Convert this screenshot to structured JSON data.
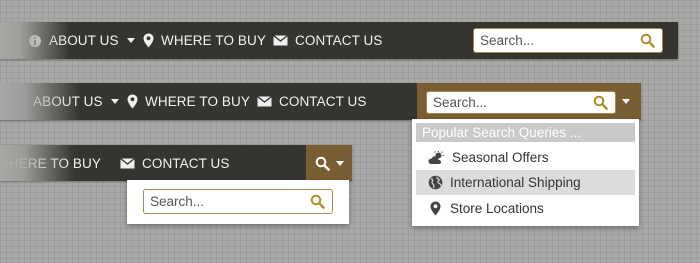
{
  "nav1": {
    "about": "ABOUT US",
    "where": "WHERE TO BUY",
    "contact": "CONTACT US",
    "search_placeholder": "Search..."
  },
  "nav2": {
    "about": "ABOUT US",
    "where": "WHERE TO BUY",
    "contact": "CONTACT US",
    "search_placeholder": "Search...",
    "dropdown": {
      "header": "Popular Search Queries ...",
      "items": [
        {
          "label": "Seasonal Offers",
          "icon": "cloud-sun-icon"
        },
        {
          "label": "International Shipping",
          "icon": "globe-icon"
        },
        {
          "label": "Store Locations",
          "icon": "map-marker-icon"
        }
      ]
    }
  },
  "nav3": {
    "where": "WHERE TO BUY",
    "contact": "CONTACT US",
    "search_placeholder": "Search..."
  },
  "colors": {
    "bar": "#353431",
    "accent": "#7b5d34",
    "search_border": "#a88b4c",
    "page": "#a8a8a6"
  }
}
